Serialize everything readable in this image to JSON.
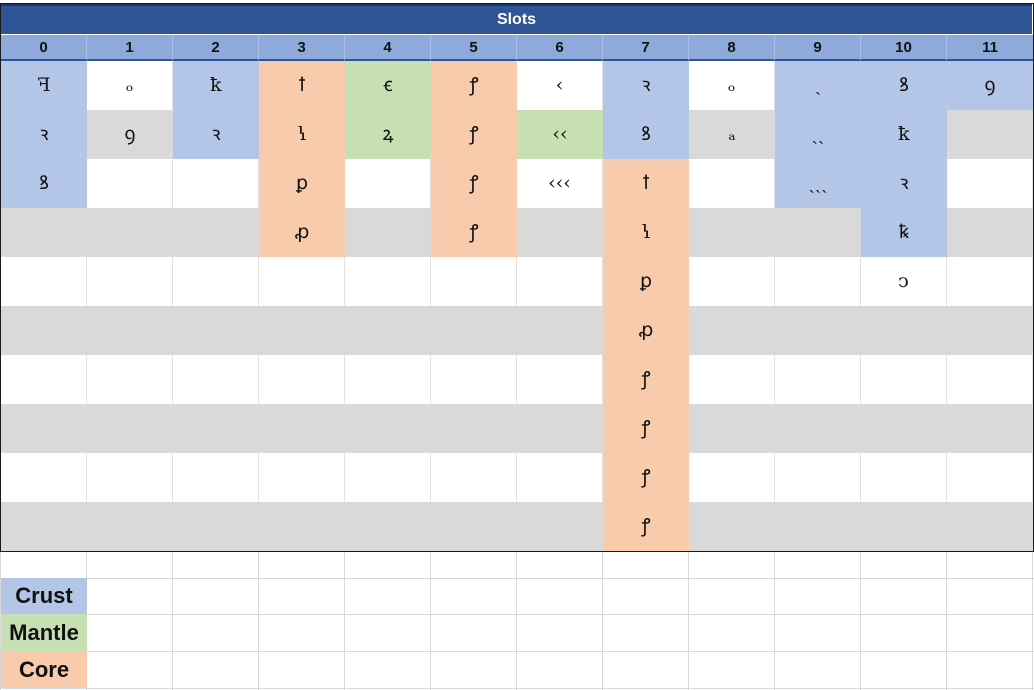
{
  "title": "Slots",
  "columns": [
    "0",
    "1",
    "2",
    "3",
    "4",
    "5",
    "6",
    "7",
    "8",
    "9",
    "10",
    "11"
  ],
  "colors": {
    "title_bg": "#2f5597",
    "header_bg": "#8eaadb",
    "crust": "#b4c6e7",
    "mantle": "#c6e0b4",
    "core": "#f8cbad",
    "band_gray": "#d9d9d9",
    "white": "#ffffff"
  },
  "table": {
    "cells": [
      [
        {
          "t": "ꟻ",
          "k": "crust"
        },
        {
          "t": "ₒ"
        },
        {
          "t": "ꝁ",
          "k": "crust"
        },
        {
          "t": "ꝉ",
          "k": "core"
        },
        {
          "t": "ꞓ",
          "k": "mantle"
        },
        {
          "t": "ꝭ",
          "k": "core"
        },
        {
          "t": "‹"
        },
        {
          "t": "ꝛ",
          "k": "crust"
        },
        {
          "t": "ₒ"
        },
        {
          "t": "ˎ",
          "k": "crust"
        },
        {
          "t": "ꝸ",
          "k": "crust"
        },
        {
          "t": "ꝯ",
          "k": "crust"
        }
      ],
      [
        {
          "t": "ꝛ",
          "k": "crust"
        },
        {
          "t": "ꝯ"
        },
        {
          "t": "ꝛ",
          "k": "crust"
        },
        {
          "t": "ꝇ",
          "k": "core"
        },
        {
          "t": "ꝝ",
          "k": "mantle"
        },
        {
          "t": "ꝭ",
          "k": "core"
        },
        {
          "t": "‹‹",
          "k": "mantle"
        },
        {
          "t": "ꝸ",
          "k": "crust"
        },
        {
          "t": "ₐ"
        },
        {
          "t": "ˎˎ",
          "k": "crust"
        },
        {
          "t": "ꝁ",
          "k": "crust"
        },
        {
          "t": ""
        }
      ],
      [
        {
          "t": "ꝸ",
          "k": "crust"
        },
        {
          "t": ""
        },
        {
          "t": ""
        },
        {
          "t": "ꝑ",
          "k": "core"
        },
        {
          "t": ""
        },
        {
          "t": "ꝭ",
          "k": "core"
        },
        {
          "t": "‹‹‹"
        },
        {
          "t": "ꝉ",
          "k": "core"
        },
        {
          "t": ""
        },
        {
          "t": "ˎˎˎ",
          "k": "crust"
        },
        {
          "t": "ꝛ",
          "k": "crust"
        },
        {
          "t": ""
        }
      ],
      [
        {
          "t": ""
        },
        {
          "t": ""
        },
        {
          "t": ""
        },
        {
          "t": "ꝓ",
          "k": "core"
        },
        {
          "t": ""
        },
        {
          "t": "ꝭ",
          "k": "core"
        },
        {
          "t": ""
        },
        {
          "t": "ꝇ",
          "k": "core"
        },
        {
          "t": ""
        },
        {
          "t": ""
        },
        {
          "t": "ꝅ",
          "k": "crust"
        },
        {
          "t": ""
        }
      ],
      [
        {
          "t": ""
        },
        {
          "t": ""
        },
        {
          "t": ""
        },
        {
          "t": ""
        },
        {
          "t": ""
        },
        {
          "t": ""
        },
        {
          "t": ""
        },
        {
          "t": "ꝑ",
          "k": "core"
        },
        {
          "t": ""
        },
        {
          "t": ""
        },
        {
          "t": "ↄ"
        },
        {
          "t": ""
        }
      ],
      [
        {
          "t": ""
        },
        {
          "t": ""
        },
        {
          "t": ""
        },
        {
          "t": ""
        },
        {
          "t": ""
        },
        {
          "t": ""
        },
        {
          "t": ""
        },
        {
          "t": "ꝓ",
          "k": "core"
        },
        {
          "t": ""
        },
        {
          "t": ""
        },
        {
          "t": ""
        },
        {
          "t": ""
        }
      ],
      [
        {
          "t": ""
        },
        {
          "t": ""
        },
        {
          "t": ""
        },
        {
          "t": ""
        },
        {
          "t": ""
        },
        {
          "t": ""
        },
        {
          "t": ""
        },
        {
          "t": "ꝭ",
          "k": "core"
        },
        {
          "t": ""
        },
        {
          "t": ""
        },
        {
          "t": ""
        },
        {
          "t": ""
        }
      ],
      [
        {
          "t": ""
        },
        {
          "t": ""
        },
        {
          "t": ""
        },
        {
          "t": ""
        },
        {
          "t": ""
        },
        {
          "t": ""
        },
        {
          "t": ""
        },
        {
          "t": "ꝭ",
          "k": "core"
        },
        {
          "t": ""
        },
        {
          "t": ""
        },
        {
          "t": ""
        },
        {
          "t": ""
        }
      ],
      [
        {
          "t": ""
        },
        {
          "t": ""
        },
        {
          "t": ""
        },
        {
          "t": ""
        },
        {
          "t": ""
        },
        {
          "t": ""
        },
        {
          "t": ""
        },
        {
          "t": "ꝭ",
          "k": "core"
        },
        {
          "t": ""
        },
        {
          "t": ""
        },
        {
          "t": ""
        },
        {
          "t": ""
        }
      ],
      [
        {
          "t": ""
        },
        {
          "t": ""
        },
        {
          "t": ""
        },
        {
          "t": ""
        },
        {
          "t": ""
        },
        {
          "t": ""
        },
        {
          "t": ""
        },
        {
          "t": "ꝭ",
          "k": "core"
        },
        {
          "t": ""
        },
        {
          "t": ""
        },
        {
          "t": ""
        },
        {
          "t": ""
        }
      ]
    ]
  },
  "legend": [
    {
      "label": "Crust",
      "kind": "crust"
    },
    {
      "label": "Mantle",
      "kind": "mantle"
    },
    {
      "label": "Core",
      "kind": "core"
    }
  ]
}
